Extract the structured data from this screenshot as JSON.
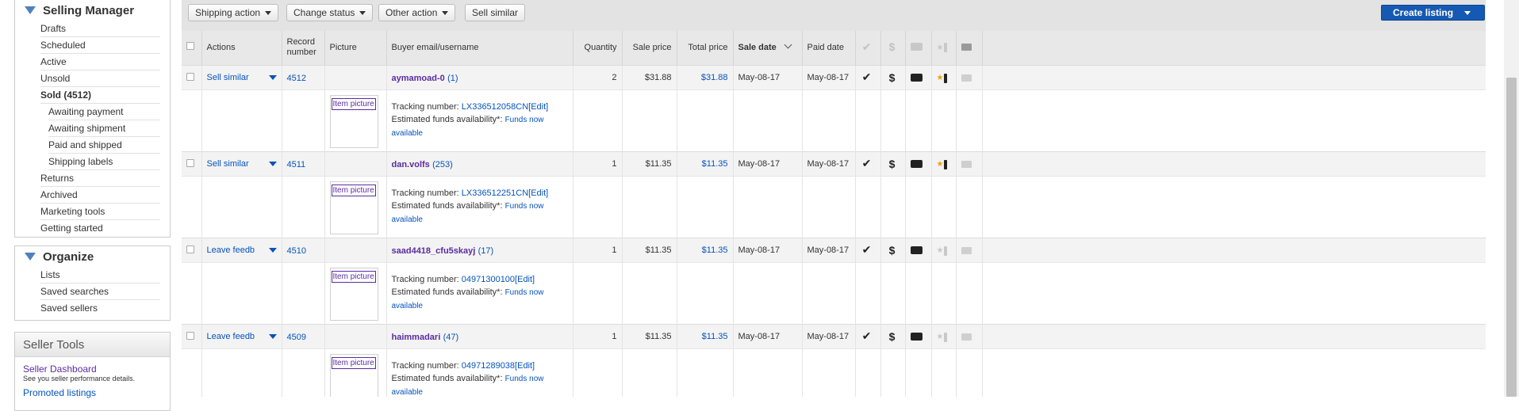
{
  "nav": {
    "title": "Selling Manager",
    "items": [
      {
        "label": "Drafts"
      },
      {
        "label": "Scheduled"
      },
      {
        "label": "Active"
      },
      {
        "label": "Unsold"
      },
      {
        "label": "Sold (4512)"
      },
      {
        "label": "Awaiting payment"
      },
      {
        "label": "Awaiting shipment"
      },
      {
        "label": "Paid and shipped"
      },
      {
        "label": "Shipping labels"
      },
      {
        "label": "Returns"
      },
      {
        "label": "Archived"
      },
      {
        "label": "Marketing tools"
      },
      {
        "label": "Getting started"
      }
    ],
    "organize_title": "Organize",
    "organize_items": [
      {
        "label": "Lists"
      },
      {
        "label": "Saved searches"
      },
      {
        "label": "Saved sellers"
      }
    ],
    "tools_title": "Seller Tools",
    "tools_link": "Seller Dashboard",
    "tools_sub": "See you seller performance details.",
    "tools_link2": "Promoted listings"
  },
  "toolbar": {
    "shipping_action": "Shipping action",
    "change_status": "Change status",
    "other_action": "Other action",
    "sell_similar": "Sell similar",
    "create_listing": "Create listing"
  },
  "columns": {
    "actions": "Actions",
    "record_line1": "Record",
    "record_line2": "number",
    "picture": "Picture",
    "buyer": "Buyer email/username",
    "quantity": "Quantity",
    "sale_price": "Sale price",
    "total_price": "Total price",
    "sale_date": "Sale date",
    "paid_date": "Paid date"
  },
  "rows": [
    {
      "action": "Sell similar",
      "record": "4512",
      "buyer": "aymamoad-0",
      "feedback": "(1)",
      "quantity": "2",
      "sale_price": "$31.88",
      "total_price": "$31.88",
      "sale_date": "May-08-17",
      "paid_date": "May-08-17",
      "picture": "Item picture",
      "tracking_label": "Tracking number:",
      "tracking": "LX336512058CN",
      "edit": "[Edit]",
      "funds_label": "Estimated funds availability*:",
      "funds_1": "Funds now",
      "funds_2": "available",
      "feedback_star": "on"
    },
    {
      "action": "Sell similar",
      "record": "4511",
      "buyer": "dan.volfs",
      "feedback": "(253)",
      "quantity": "1",
      "sale_price": "$11.35",
      "total_price": "$11.35",
      "sale_date": "May-08-17",
      "paid_date": "May-08-17",
      "picture": "Item picture",
      "tracking_label": "Tracking number:",
      "tracking": "LX336512251CN",
      "edit": "[Edit]",
      "funds_label": "Estimated funds availability*:",
      "funds_1": "Funds now",
      "funds_2": "available",
      "feedback_star": "on"
    },
    {
      "action": "Leave feedb",
      "record": "4510",
      "buyer": "saad4418_cfu5skayj",
      "feedback": "(17)",
      "quantity": "1",
      "sale_price": "$11.35",
      "total_price": "$11.35",
      "sale_date": "May-08-17",
      "paid_date": "May-08-17",
      "picture": "Item picture",
      "tracking_label": "Tracking number:",
      "tracking": "04971300100",
      "edit": "[Edit]",
      "funds_label": "Estimated funds availability*:",
      "funds_1": "Funds now",
      "funds_2": "available",
      "feedback_star": "off"
    },
    {
      "action": "Leave feedb",
      "record": "4509",
      "buyer": "haimmadari",
      "feedback": "(47)",
      "quantity": "1",
      "sale_price": "$11.35",
      "total_price": "$11.35",
      "sale_date": "May-08-17",
      "paid_date": "May-08-17",
      "picture": "Item picture",
      "tracking_label": "Tracking number:",
      "tracking": "04971289038",
      "edit": "[Edit]",
      "funds_label": "Estimated funds availability*:",
      "funds_1": "Funds now",
      "funds_2": "available",
      "feedback_star": "off"
    }
  ],
  "status_icons": [
    "checkmark-icon",
    "dollar-icon",
    "truck-icon",
    "feedback-star-icon",
    "envelope-icon"
  ],
  "colors": {
    "accent": "#0654ba",
    "visited": "#5a2ca0",
    "create_button": "#1659b2",
    "nav_triangle": "#4f81bd",
    "feedback_star": "#f0a30a"
  }
}
